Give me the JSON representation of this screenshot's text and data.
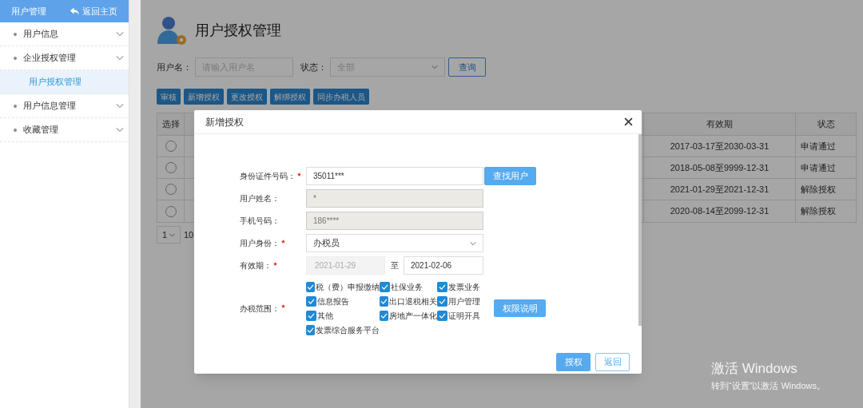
{
  "sidebar": {
    "title": "用户管理",
    "back_link": "返回主页",
    "items": [
      {
        "label": "用户信息"
      },
      {
        "label": "企业授权管理",
        "children": [
          {
            "label": "用户授权管理",
            "selected": true
          }
        ]
      },
      {
        "label": "用户信息管理"
      },
      {
        "label": "收藏管理"
      }
    ]
  },
  "page": {
    "title": "用户授权管理",
    "filters": {
      "username_label": "用户名：",
      "username_placeholder": "请输入用户名",
      "status_label": "状态：",
      "status_value": "全部",
      "query_button": "查询"
    },
    "toolbar": [
      "审核",
      "新增授权",
      "更改授权",
      "解绑授权",
      "同步办税人员"
    ],
    "table": {
      "columns": [
        "选择",
        "有效期",
        "状态"
      ],
      "rows": [
        {
          "selected": false,
          "validity": "2017-03-17至2030-03-31",
          "status": "申请通过"
        },
        {
          "selected": false,
          "validity": "2018-05-08至9999-12-31",
          "status": "申请通过"
        },
        {
          "selected": false,
          "validity": "2021-01-29至2021-12-31",
          "status": "解除授权"
        },
        {
          "selected": false,
          "validity": "2020-08-14至2099-12-31",
          "status": "解除授权"
        }
      ]
    },
    "pagination": {
      "page": "1",
      "page_size": "10"
    }
  },
  "modal": {
    "title": "新增授权",
    "fields": [
      {
        "kind": "text",
        "label": "身份证件号码：",
        "required": true,
        "value": "35011***",
        "disabled": false,
        "button": "查找用户"
      },
      {
        "kind": "text",
        "label": "用户姓名：",
        "required": false,
        "value": "*",
        "disabled": true
      },
      {
        "kind": "text",
        "label": "手机号码：",
        "required": false,
        "value": "186****",
        "disabled": true
      },
      {
        "kind": "select",
        "label": "用户身份：",
        "required": true,
        "value": "办税员"
      },
      {
        "kind": "daterange",
        "label": "有效期：",
        "required": true,
        "from": "2021-01-29",
        "separator": "至",
        "to": "2021-02-06"
      },
      {
        "kind": "checkgroup",
        "label": "办税范围：",
        "required": true,
        "button": "权限说明",
        "options": [
          {
            "label": "税（费）申报缴纳",
            "checked": true
          },
          {
            "label": "社保业务",
            "checked": true
          },
          {
            "label": "发票业务",
            "checked": true
          },
          {
            "label": "信息报告",
            "checked": true
          },
          {
            "label": "出口退税相关",
            "checked": true
          },
          {
            "label": "用户管理",
            "checked": true
          },
          {
            "label": "其他",
            "checked": true
          },
          {
            "label": "房地产一体化",
            "checked": true
          },
          {
            "label": "证明开具",
            "checked": true
          },
          {
            "label": "发票综合服务平台",
            "checked": true
          }
        ]
      }
    ],
    "buttons": [
      {
        "label": "授权",
        "kind": "primary"
      },
      {
        "label": "返回",
        "kind": "secondary"
      }
    ]
  },
  "os_notice": {
    "title": "激活 Windows",
    "subtitle": "转到“设置”以激活 Windows。"
  }
}
